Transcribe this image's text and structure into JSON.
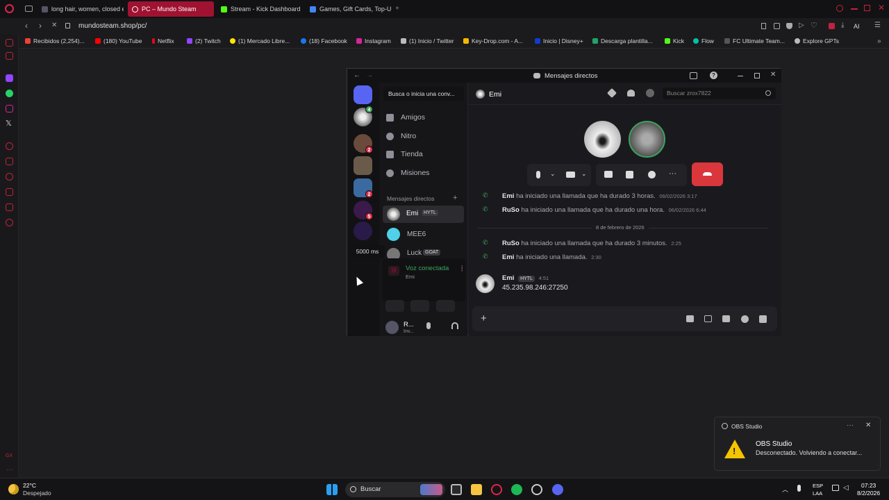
{
  "browser": {
    "tabs": [
      {
        "label": "long hair, women, closed e"
      },
      {
        "label": "PC – Mundo Steam",
        "active": true
      },
      {
        "label": "Stream - Kick Dashboard"
      },
      {
        "label": "Games, Gift Cards, Top-Up"
      }
    ],
    "url": "mundosteam.shop/pc/",
    "bookmarks": [
      "Recibidos (2,254)...",
      "(180) YouTube",
      "Netflix",
      "(2) Twitch",
      "(1) Mercado Libre...",
      "(18) Facebook",
      "Instagram",
      "(1) Inicio / Twitter",
      "Key-Drop.com - A...",
      "Inicio | Disney+",
      "Descarga plantilla...",
      "Kick",
      "Flow",
      "FC Ultimate Team...",
      "Explore GPTs"
    ],
    "ai_label": "AI"
  },
  "discord": {
    "window_title": "Mensajes directos",
    "search_dm": "Busca o inicia una conv...",
    "nav": [
      "Amigos",
      "Nitro",
      "Tienda",
      "Misiones"
    ],
    "dm_header": "Mensajes directos",
    "dms": [
      {
        "name": "Emi",
        "tag": "HYTL"
      },
      {
        "name": "MEE6",
        "tag": ""
      },
      {
        "name": "Luck",
        "tag": "GOAT"
      }
    ],
    "server_badges": [
      "4",
      "2",
      "2",
      "5"
    ],
    "tooltip": "5000 ms",
    "voice": {
      "status": "Voz conectada",
      "channel": "Emi"
    },
    "user": {
      "name": "R...",
      "status": "Inv..."
    },
    "chat": {
      "title": "Emi",
      "search_placeholder": "Buscar zrox7822",
      "messages": [
        {
          "user": "Emi",
          "text": "ha iniciado una llamada que ha durado 3 horas.",
          "time": "06/02/2026 3:17"
        },
        {
          "user": "RuSo",
          "text": "ha iniciado una llamada que ha durado una hora.",
          "time": "06/02/2026 6:44"
        },
        {
          "user": "RuSo",
          "text": "ha iniciado una llamada que ha durado 3 minutos.",
          "time": "2:25"
        },
        {
          "user": "Emi",
          "text": "ha iniciado una llamada.",
          "time": "2:30"
        }
      ],
      "date_divider": "8 de febrero de 2026",
      "last_message": {
        "user": "Emi",
        "tag": "HYTL",
        "time": "4:51",
        "text": "45.235.98.246:27250"
      }
    }
  },
  "toast": {
    "app": "OBS Studio",
    "title": "OBS Studio",
    "body": "Desconectado. Volviendo a conectar..."
  },
  "taskbar": {
    "weather_temp": "22°C",
    "weather_desc": "Despejado",
    "search": "Buscar",
    "lang_top": "ESP",
    "lang_bottom": "LAA",
    "time": "07:23",
    "date": "8/2/2026"
  },
  "colors": {
    "accent": "#a01231",
    "discord_blurple": "#5865f2",
    "hangup": "#da373c",
    "green": "#3ba55d"
  }
}
